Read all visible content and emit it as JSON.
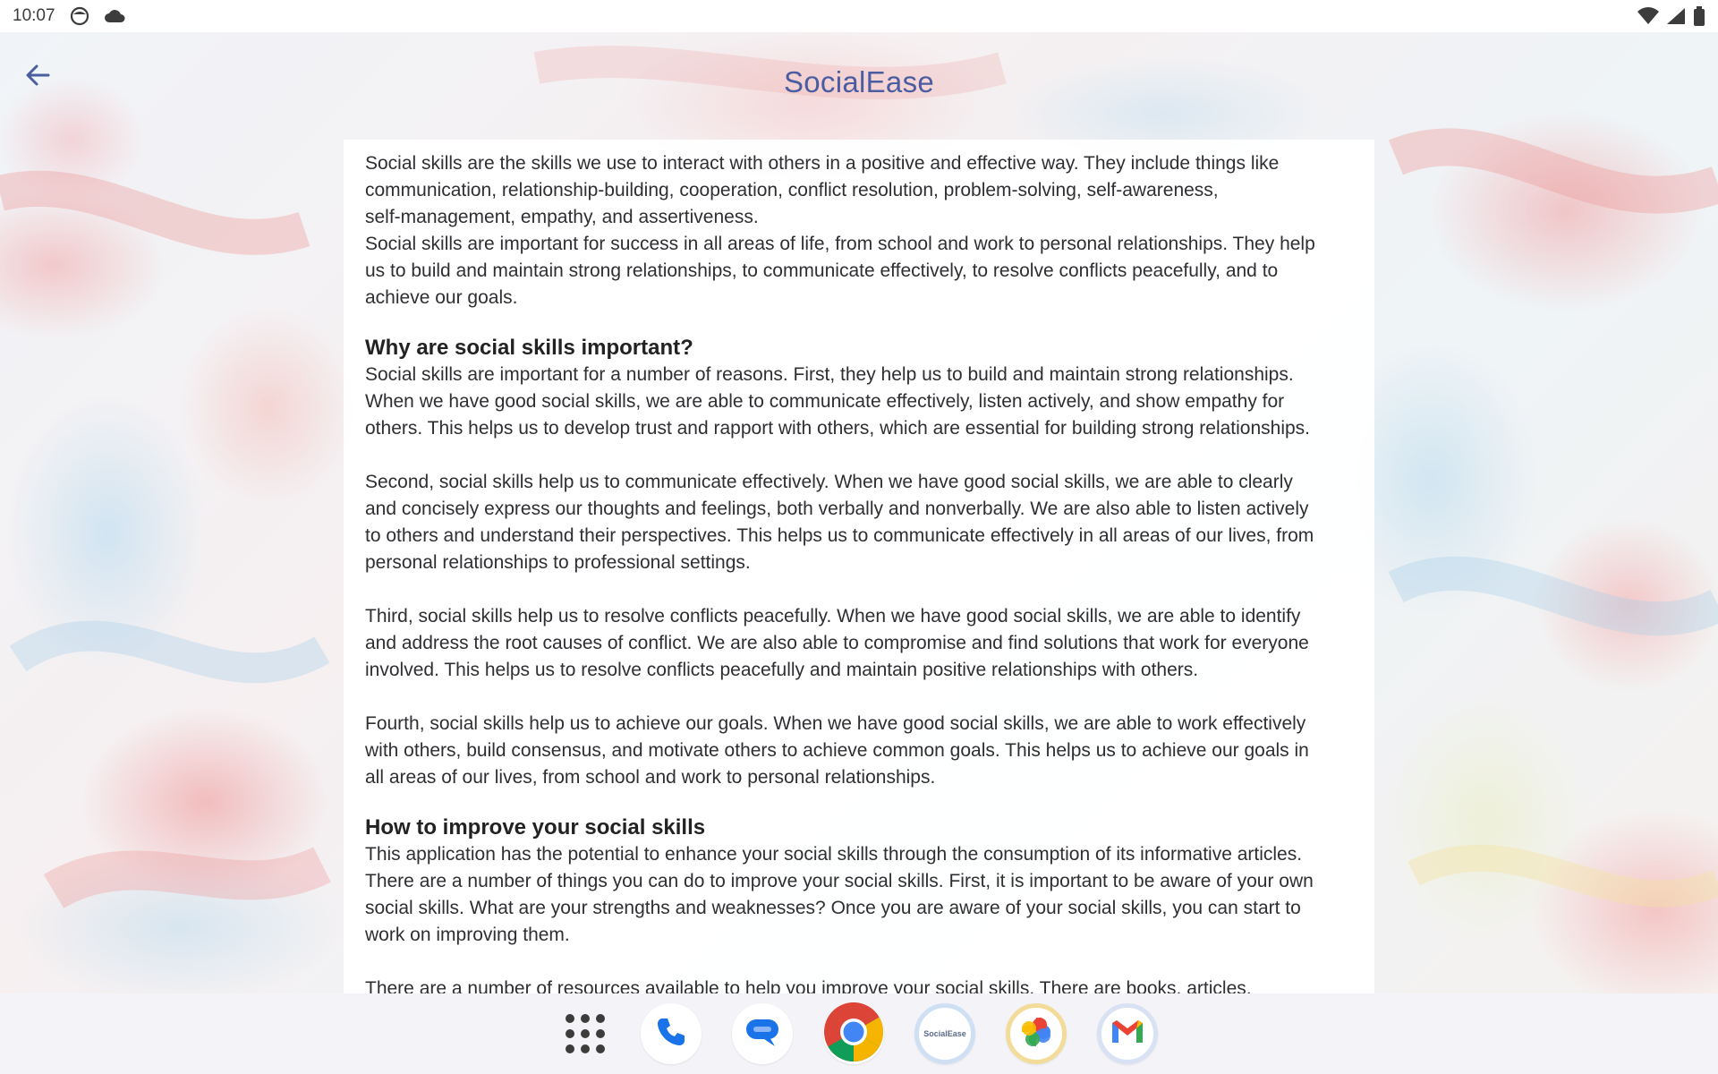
{
  "status_bar": {
    "time": "10:07",
    "icons_left": [
      "face-icon",
      "cloud-icon"
    ],
    "icons_right": [
      "wifi-icon",
      "signal-icon",
      "battery-icon"
    ]
  },
  "app_bar": {
    "title": "SocialEase",
    "back_icon": "arrow-back-icon",
    "title_color": "#4a5da0"
  },
  "article": {
    "intro_1": "Social skills are the skills we use to interact with others in a positive and effective way. They include things like\ncommunication, relationship-building, cooperation, conflict resolution, problem-solving, self-awareness,\nself-management, empathy, and assertiveness.",
    "intro_2": "Social skills are important for success in all areas of life, from school and work to personal relationships. They help\nus to build and maintain strong relationships, to communicate effectively, to resolve conflicts peacefully, and to\nachieve our goals.",
    "heading_1": "Why are social skills important?",
    "why_1": "Social skills are important for a number of reasons. First, they help us to build and maintain strong relationships.\nWhen we have good social skills, we are able to communicate effectively, listen actively, and show empathy for\nothers. This helps us to develop trust and rapport with others, which are essential for building strong relationships.",
    "why_2": "Second, social skills help us to communicate effectively. When we have good social skills, we are able to clearly\nand concisely express our thoughts and feelings, both verbally and nonverbally. We are also able to listen actively\nto others and understand their perspectives. This helps us to communicate effectively in all areas of our lives, from\npersonal relationships to professional settings.",
    "why_3": "Third, social skills help us to resolve conflicts peacefully. When we have good social skills, we are able to identify\nand address the root causes of conflict. We are also able to compromise and find solutions that work for everyone\ninvolved. This helps us to resolve conflicts peacefully and maintain positive relationships with others.",
    "why_4": "Fourth, social skills help us to achieve our goals. When we have good social skills, we are able to work effectively\nwith others, build consensus, and motivate others to achieve common goals. This helps us to achieve our goals in\nall areas of our lives, from school and work to personal relationships.",
    "heading_2": "How to improve your social skills",
    "how_1": "This application has the potential to enhance your social skills through the consumption of its informative articles.\nThere are a number of things you can do to improve your social skills. First, it is important to be aware of your own\nsocial skills. What are your strengths and weaknesses? Once you are aware of your social skills, you can start to\nwork on improving them.",
    "how_2": "There are a number of resources available to help you improve your social skills. There are books, articles,"
  },
  "dock": {
    "items": [
      {
        "name": "app-drawer",
        "icon": "apps-grid-icon"
      },
      {
        "name": "phone",
        "icon": "phone-icon"
      },
      {
        "name": "messages",
        "icon": "messages-icon"
      },
      {
        "name": "chrome",
        "icon": "chrome-icon"
      },
      {
        "name": "socialease",
        "icon": "socialease-icon",
        "label": "SocialEase"
      },
      {
        "name": "photos",
        "icon": "photos-icon"
      },
      {
        "name": "gmail",
        "icon": "gmail-icon"
      }
    ]
  }
}
